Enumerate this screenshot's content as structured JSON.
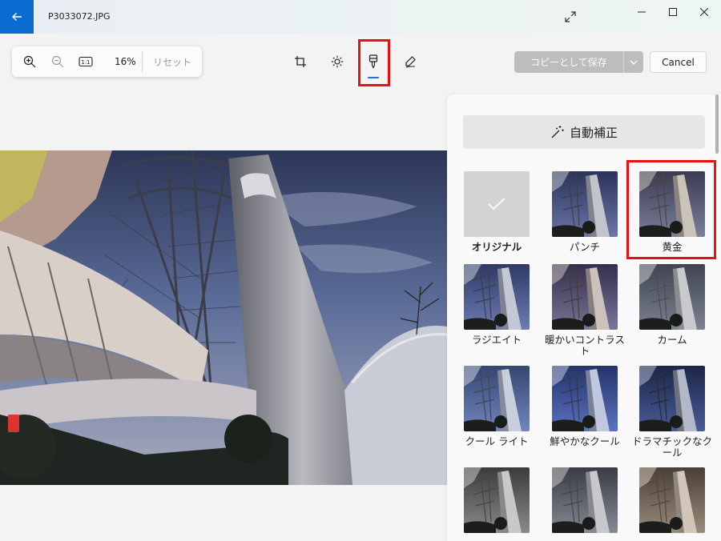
{
  "window": {
    "file_name": "P3033072.JPG"
  },
  "zoom_toolbar": {
    "zoom_level": "16%",
    "reset_label": "リセット",
    "actual_size_label": "1:1"
  },
  "actions": {
    "save_copy_label": "コピーとして保存",
    "cancel_label": "Cancel"
  },
  "panel": {
    "auto_enhance_label": "自動補正",
    "filters": [
      {
        "label": "オリジナル",
        "tone": "none",
        "selected": true
      },
      {
        "label": "パンチ",
        "tone": "punch"
      },
      {
        "label": "黄金",
        "tone": "golden"
      },
      {
        "label": "ラジエイト",
        "tone": "radiate"
      },
      {
        "label": "暖かいコントラスト",
        "tone": "warm"
      },
      {
        "label": "カーム",
        "tone": "calm"
      },
      {
        "label": "クール ライト",
        "tone": "coollight"
      },
      {
        "label": "鮮やかなクール",
        "tone": "vivid"
      },
      {
        "label": "ドラマチックなクール",
        "tone": "dramatic"
      },
      {
        "label": "",
        "tone": "mono"
      },
      {
        "label": "",
        "tone": "mono2"
      },
      {
        "label": "",
        "tone": "warm2"
      }
    ]
  },
  "colors": {
    "accent": "#0a6cd1",
    "highlight": "#e81212"
  }
}
